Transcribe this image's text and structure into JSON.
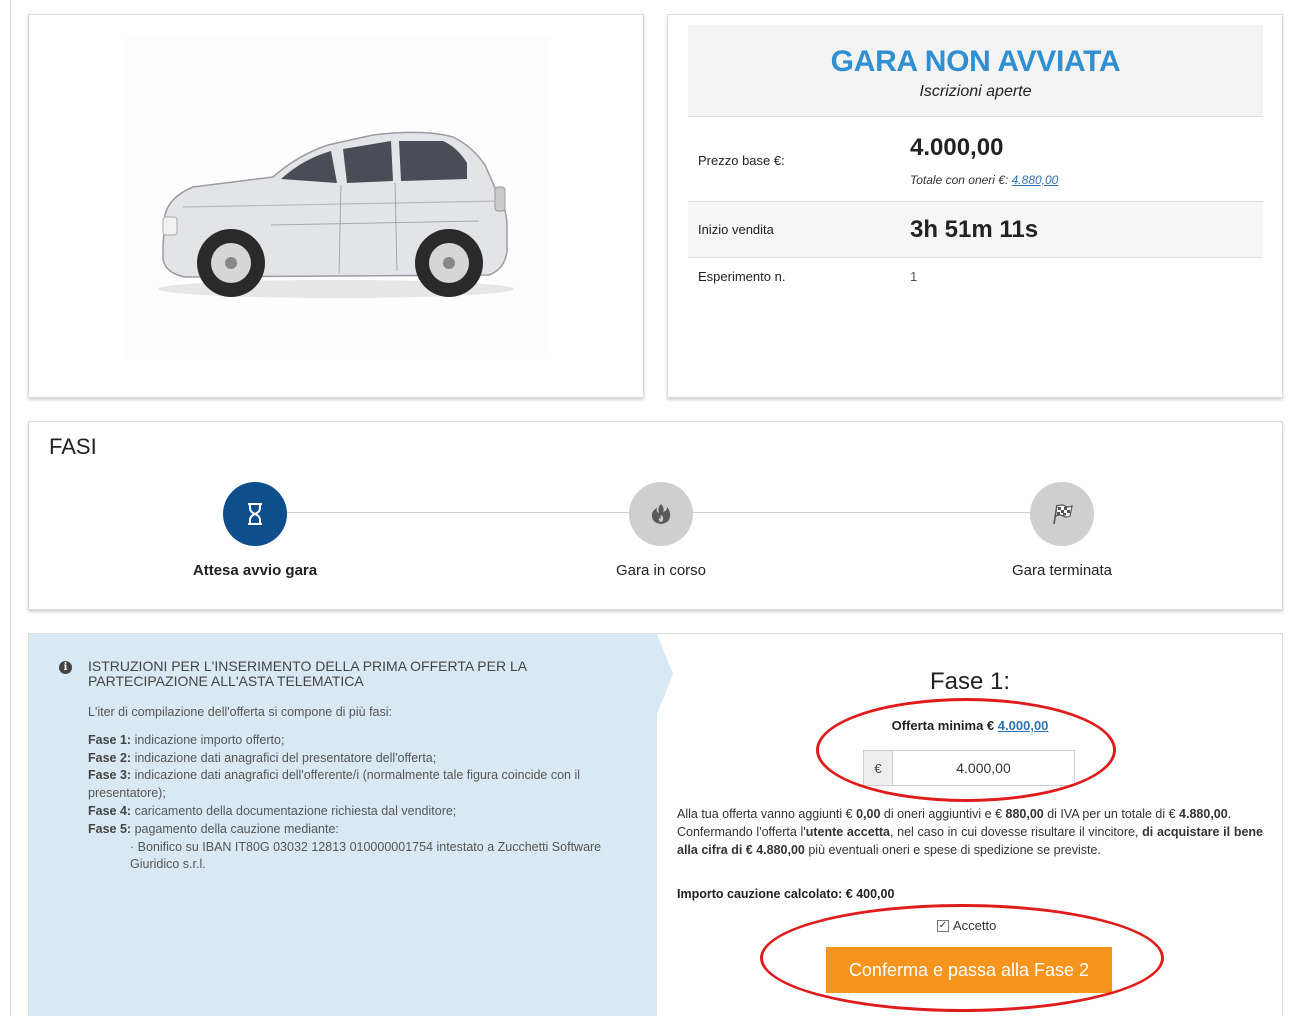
{
  "status": {
    "title": "GARA NON AVVIATA",
    "subtitle": "Iscrizioni aperte"
  },
  "details": {
    "price_label": "Prezzo base €:",
    "price_value": "4.000,00",
    "total_label": "Totale con oneri €:",
    "total_value": "4.880,00",
    "start_label": "Inizio vendita",
    "start_value": "3h 51m 11s",
    "experiment_label": "Esperimento n.",
    "experiment_value": "1"
  },
  "fasi": {
    "title": "FASI",
    "steps": [
      {
        "label": "Attesa avvio gara",
        "icon": "hourglass-icon",
        "active": true
      },
      {
        "label": "Gara in corso",
        "icon": "fire-icon",
        "active": false
      },
      {
        "label": "Gara terminata",
        "icon": "checkered-flag-icon",
        "active": false
      }
    ]
  },
  "instructions": {
    "title_line1": "ISTRUZIONI PER L'INSERIMENTO DELLA PRIMA OFFERTA PER LA",
    "title_line2": "PARTECIPAZIONE ALL'ASTA TELEMATICA",
    "intro": "L'iter di compilazione dell'offerta si compone di più fasi:",
    "phases": [
      {
        "name": "Fase 1:",
        "text": " indicazione importo offerto;"
      },
      {
        "name": "Fase 2:",
        "text": " indicazione dati anagrafici del presentatore dell'offerta;"
      },
      {
        "name": "Fase 3:",
        "text": " indicazione dati anagrafici dell'offerente/i (normalmente tale figura coincide con il presentatore);"
      },
      {
        "name": "Fase 4:",
        "text": " caricamento della documentazione richiesta dal venditore;"
      },
      {
        "name": "Fase 5:",
        "text": " pagamento della cauzione mediante:"
      }
    ],
    "bullet": "· Bonifico su IBAN IT80G 03032 12813 010000001754 intestato a Zucchetti Software Giuridico s.r.l."
  },
  "bid": {
    "fase_title": "Fase 1:",
    "min_offer_label": "Offerta minima €",
    "min_offer_value": "4.000,00",
    "currency": "€",
    "amount": "4.000,00",
    "text1": "Alla tua offerta vanno aggiunti €",
    "oneri": "0,00",
    "text2": " di oneri aggiuntivi e €",
    "iva": "880,00",
    "text3": " di IVA per un totale di €",
    "totale": "4.880,00",
    "text4": "Confermando l'offerta l'",
    "utente": "utente accetta",
    "text5": ", nel caso in cui dovesse risultare il vincitore, ",
    "acquisto": "di acquistare il bene alla cifra di € 4.880,00",
    "text6": " più eventuali oneri e spese di spedizione se previste.",
    "caution": "Importo cauzione calcolato: € 400,00",
    "accept_label": "Accetto",
    "accept_checked": true,
    "confirm_label": "Conferma e passa alla Fase 2"
  },
  "colors": {
    "status_blue": "#2f8fd0",
    "active_step": "#0e4e8c",
    "button_orange": "#f7941d",
    "annotation_red": "#e01b1b"
  }
}
